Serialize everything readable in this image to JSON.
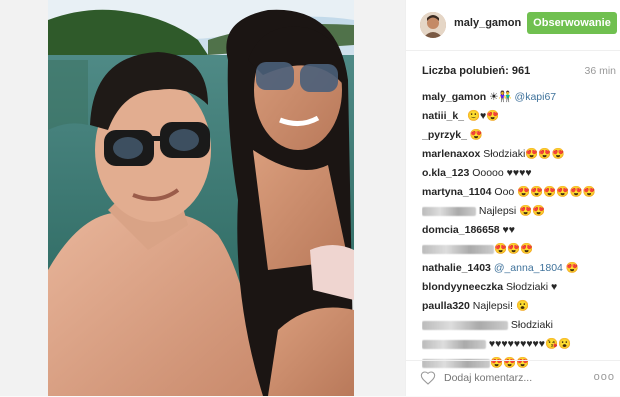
{
  "header": {
    "username": "maly_gamon",
    "follow_label": "Obserwowanie"
  },
  "stats": {
    "likes": "Liczba polubień: 961",
    "time": "36 min"
  },
  "comments": [
    {
      "user": "maly_gamon",
      "text": " ☀👫 ",
      "mention": "@kapi67"
    },
    {
      "user": "natiii_k_",
      "text": " 🙂♥😍"
    },
    {
      "user": "_pyrzyk_",
      "text": " 😍"
    },
    {
      "user": "marlenaxox",
      "text": " Słodziaki😍😍😍"
    },
    {
      "user": "o.kla_123",
      "text": " Ooooo ♥♥♥♥"
    },
    {
      "user": "martyna_1104",
      "text": " Ooo 😍😍😍😍😍😍"
    },
    {
      "user": "",
      "text": " Najlepsi 😍😍"
    },
    {
      "user": "domcia_186658",
      "text": " ♥♥"
    },
    {
      "user": "",
      "text": "😍😍😍"
    },
    {
      "user": "nathalie_1403",
      "text": " ",
      "mention": "@_anna_1804",
      "tail": " 😍"
    },
    {
      "user": "blondyyneeczka",
      "text": " Słodziaki ♥"
    },
    {
      "user": "paulla320",
      "text": " Najlepsi! 😮"
    },
    {
      "user": "",
      "text": " Słodziaki"
    },
    {
      "user": "",
      "text": " ♥♥♥♥♥♥♥♥♥😘😮"
    },
    {
      "user": "",
      "text": "😍😍😍"
    }
  ],
  "footer": {
    "add_comment_placeholder": "Dodaj komentarz...",
    "more_label": "ooo"
  }
}
